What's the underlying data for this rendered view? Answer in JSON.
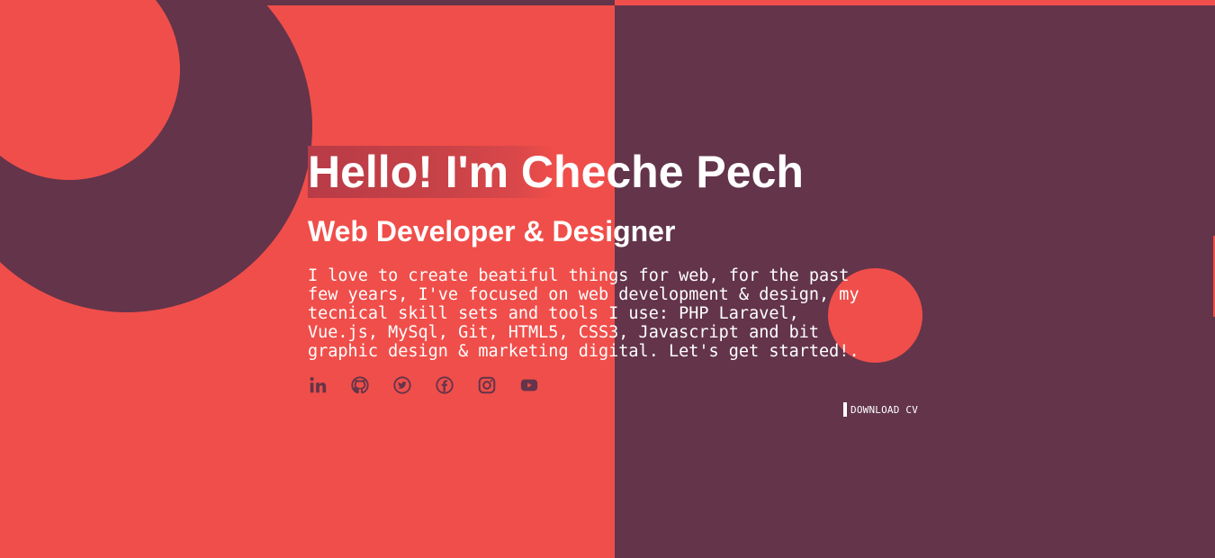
{
  "colors": {
    "primary": "#f04e4a",
    "secondary": "#63344a",
    "text": "#ffffff"
  },
  "hero": {
    "greeting": "Hello! I'm Cheche Pech",
    "role": "Web Developer & Designer",
    "bio_lines": [
      "I love to create beatiful things for web, for the past",
      "few years, I've focused on web development & design, my",
      "tecnical skill sets and tools I use: PHP Laravel,",
      "Vue.js, MySql, Git, HTML5, CSS3, Javascript and bit",
      "graphic design & marketing digital. Let's get started!."
    ]
  },
  "socials": [
    {
      "icon": "linkedin-icon"
    },
    {
      "icon": "github-icon"
    },
    {
      "icon": "twitter-icon"
    },
    {
      "icon": "facebook-icon"
    },
    {
      "icon": "instagram-icon"
    },
    {
      "icon": "youtube-icon"
    }
  ],
  "cta": {
    "download_label": "DOWNLOAD CV"
  }
}
